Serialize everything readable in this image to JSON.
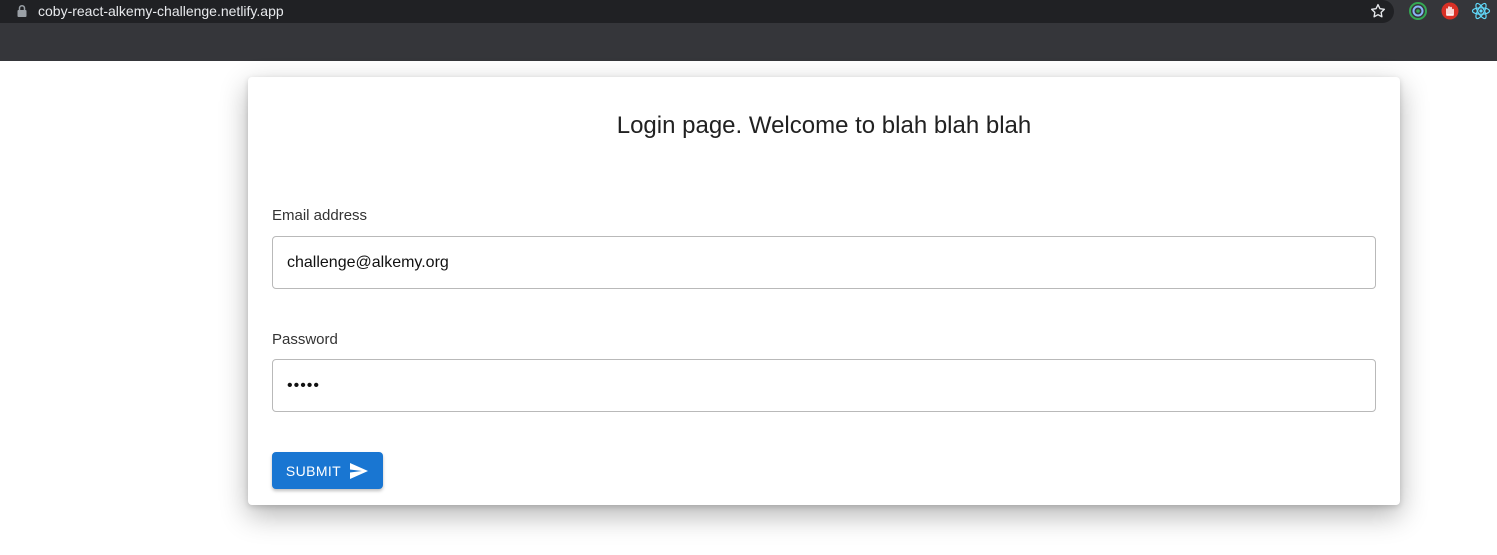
{
  "browser": {
    "url": "coby-react-alkemy-challenge.netlify.app",
    "icons": [
      "lock-icon",
      "star-icon",
      "extension-target-icon",
      "extension-hand-icon",
      "extension-react-icon"
    ]
  },
  "login": {
    "title": "Login page. Welcome to blah blah blah",
    "email_label": "Email address",
    "email_value": "challenge@alkemy.org",
    "password_label": "Password",
    "password_value": "react",
    "submit_label": "SUBMIT",
    "submit_icon": "send-icon"
  },
  "colors": {
    "browser_bar": "#35363a",
    "address_bar": "#202124",
    "primary": "#1976d2",
    "text": "#212121"
  }
}
